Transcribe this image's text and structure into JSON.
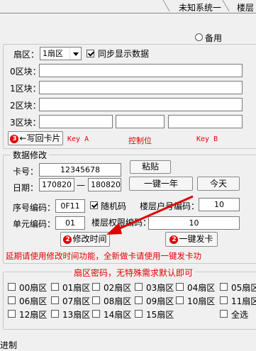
{
  "tabs": [
    "未知系统一",
    "楼层"
  ],
  "sector_panel": {
    "radio_label": "备用",
    "sector_label": "扇区：",
    "sector_value": "1扇区",
    "sync_label": "同步显示数据",
    "block_labels": [
      "0区块：",
      "1区块：",
      "2区块：",
      "3区块："
    ],
    "writeback_badge": "3",
    "writeback_label": "←写回卡片",
    "key_a": "Key A",
    "control": "控制位",
    "key_b": "Key B"
  },
  "modify_panel": {
    "title": "数据修改",
    "card_label": "卡号：",
    "card_value": "12345678",
    "paste_label": "粘贴",
    "date_label": "日期：",
    "date_start": "170820",
    "date_dash": "—",
    "date_end": "180820",
    "one_year_label": "一键一年",
    "today_label": "今天",
    "serial_label": "序号编码：",
    "serial_value": "0F11",
    "random_label": "随机码",
    "floor_room_label": "楼层户号编码：",
    "floor_room_value": "10",
    "unit_label": "单元编码：",
    "unit_value": "01",
    "floor_auth_label": "楼层权限编码：",
    "floor_auth_value": "10",
    "modify_time_badge": "2",
    "modify_time_label": "修改时间",
    "issue_badge": "2",
    "issue_label": "一键发卡",
    "hint": "延期请使用修改时间功能，全新做卡请使用一键发卡功"
  },
  "password_panel": {
    "title": "扇区密码，无特殊需求默认即可",
    "sectors": [
      "00扇区",
      "01扇区",
      "02扇区",
      "03扇区",
      "04扇区",
      "05扇区",
      "06扇区",
      "07扇区",
      "08扇区",
      "09扇区",
      "10扇区",
      "11扇区",
      "12扇区",
      "13扇区",
      "14扇区",
      "15扇区"
    ],
    "select_all": "全选"
  },
  "status_text": "进制"
}
